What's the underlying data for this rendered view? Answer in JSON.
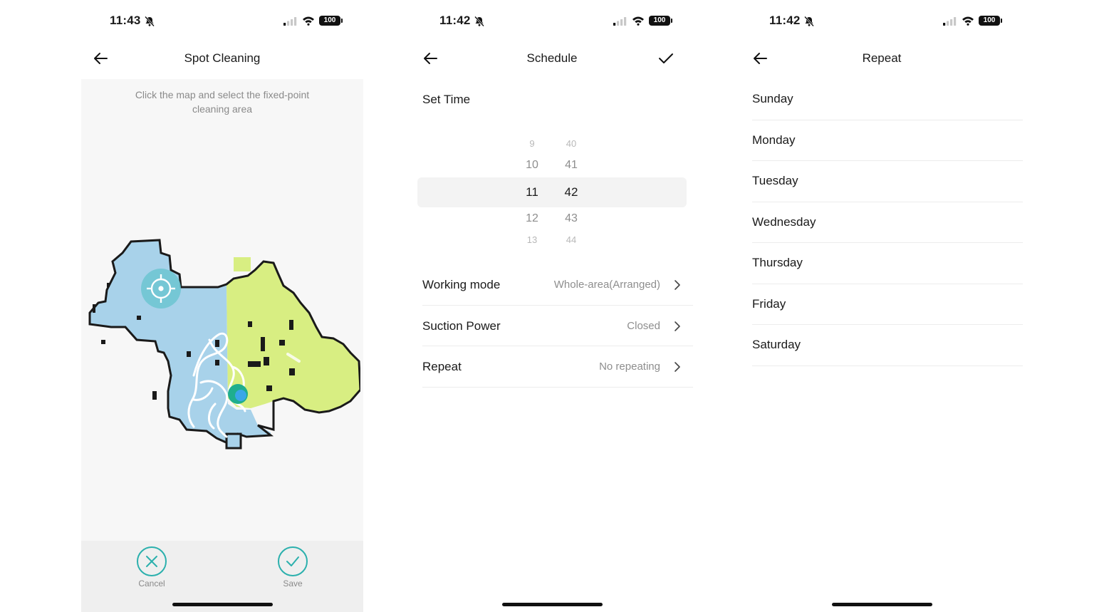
{
  "colors": {
    "accent": "#2bb0ad",
    "map_blue": "#a8d2ea",
    "map_green": "#d8ee82",
    "wall": "#1a1a1a"
  },
  "screens": [
    {
      "status": {
        "time": "11:43",
        "battery": "100"
      },
      "title": "Spot Cleaning",
      "hint": "Click the map and select the fixed-point cleaning area",
      "cancel_label": "Cancel",
      "save_label": "Save"
    },
    {
      "status": {
        "time": "11:42",
        "battery": "100"
      },
      "title": "Schedule",
      "set_time_label": "Set Time",
      "picker": {
        "hours": [
          "9",
          "10",
          "11",
          "12",
          "13"
        ],
        "minutes": [
          "40",
          "41",
          "42",
          "43",
          "44"
        ],
        "selected_hour": "11",
        "selected_minute": "42"
      },
      "settings": [
        {
          "label": "Working mode",
          "value": "Whole-area(Arranged)"
        },
        {
          "label": "Suction Power",
          "value": "Closed"
        },
        {
          "label": "Repeat",
          "value": "No repeating"
        }
      ]
    },
    {
      "status": {
        "time": "11:42",
        "battery": "100"
      },
      "title": "Repeat",
      "days": [
        "Sunday",
        "Monday",
        "Tuesday",
        "Wednesday",
        "Thursday",
        "Friday",
        "Saturday"
      ]
    }
  ],
  "icons": {
    "back": "arrow-left-icon",
    "confirm": "checkmark-icon",
    "chevron": "chevron-right-icon",
    "cancel": "close-icon",
    "save": "checkmark-icon",
    "target": "crosshair-target-icon",
    "robot": "robot-position-icon"
  }
}
